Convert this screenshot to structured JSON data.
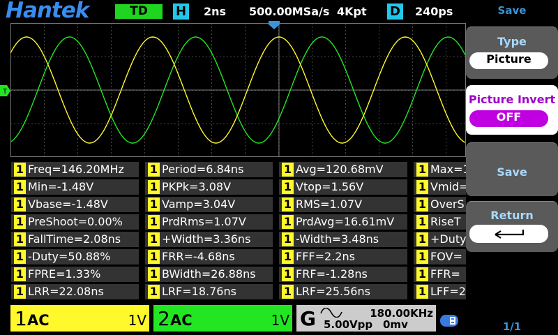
{
  "header": {
    "brand": "Hantek",
    "mode": "TD",
    "horizontal_badge": "H",
    "timebase": "2ns",
    "sample_rate": "500.00MSa/s",
    "memory_depth": "4Kpt",
    "delay_badge": "D",
    "delay": "240ps"
  },
  "colors": {
    "ch1": "#fff82a",
    "ch2": "#23e623",
    "accent": "#3a94d8",
    "menu_pill": "#c000e0"
  },
  "measurements": [
    [
      "Freq=146.20MHz",
      "Period=6.84ns",
      "Avg=120.68mV",
      "Max=1"
    ],
    [
      "Min=-1.48V",
      "PKPk=3.08V",
      "Vtop=1.56V",
      "Vmid="
    ],
    [
      "Vbase=-1.48V",
      "Vamp=3.04V",
      "RMS=1.07V",
      "OverS"
    ],
    [
      "PreShoot=0.00%",
      "PrdRms=1.07V",
      "PrdAvg=16.61mV",
      "RiseT"
    ],
    [
      "FallTime=2.08ns",
      "+Width=3.36ns",
      "-Width=3.48ns",
      "+Duty"
    ],
    [
      "-Duty=50.88%",
      "FRR=-4.68ns",
      "FFF=2.2ns",
      "FOV="
    ],
    [
      "FPRE=1.33%",
      "BWidth=26.88ns",
      "FRF=-1.28ns",
      "FFR="
    ],
    [
      "LRR=22.08ns",
      "LRF=18.76ns",
      "LRF=25.56ns",
      "LFF=2"
    ]
  ],
  "measurement_channel": "1",
  "channels": [
    {
      "num": "1",
      "coupling": "AC",
      "scale": "1V"
    },
    {
      "num": "2",
      "coupling": "AC",
      "scale": "1V"
    }
  ],
  "generator": {
    "label": "G",
    "waveform_icon": "sine-wave-icon",
    "frequency": "180.00KHz",
    "amplitude": "5.00Vpp",
    "offset": "0mv"
  },
  "menu": {
    "title": "Save",
    "type_label": "Type",
    "type_value": "Picture",
    "invert_label": "Picture Invert",
    "invert_value": "OFF",
    "save_label": "Save",
    "return_label": "Return",
    "return_icon": "return-arrow-icon",
    "page": "1/1"
  },
  "icons": {
    "trigger_level": "trigger-level-marker-icon",
    "trigger_position": "trigger-position-marker-icon",
    "usb": "usb-icon"
  }
}
